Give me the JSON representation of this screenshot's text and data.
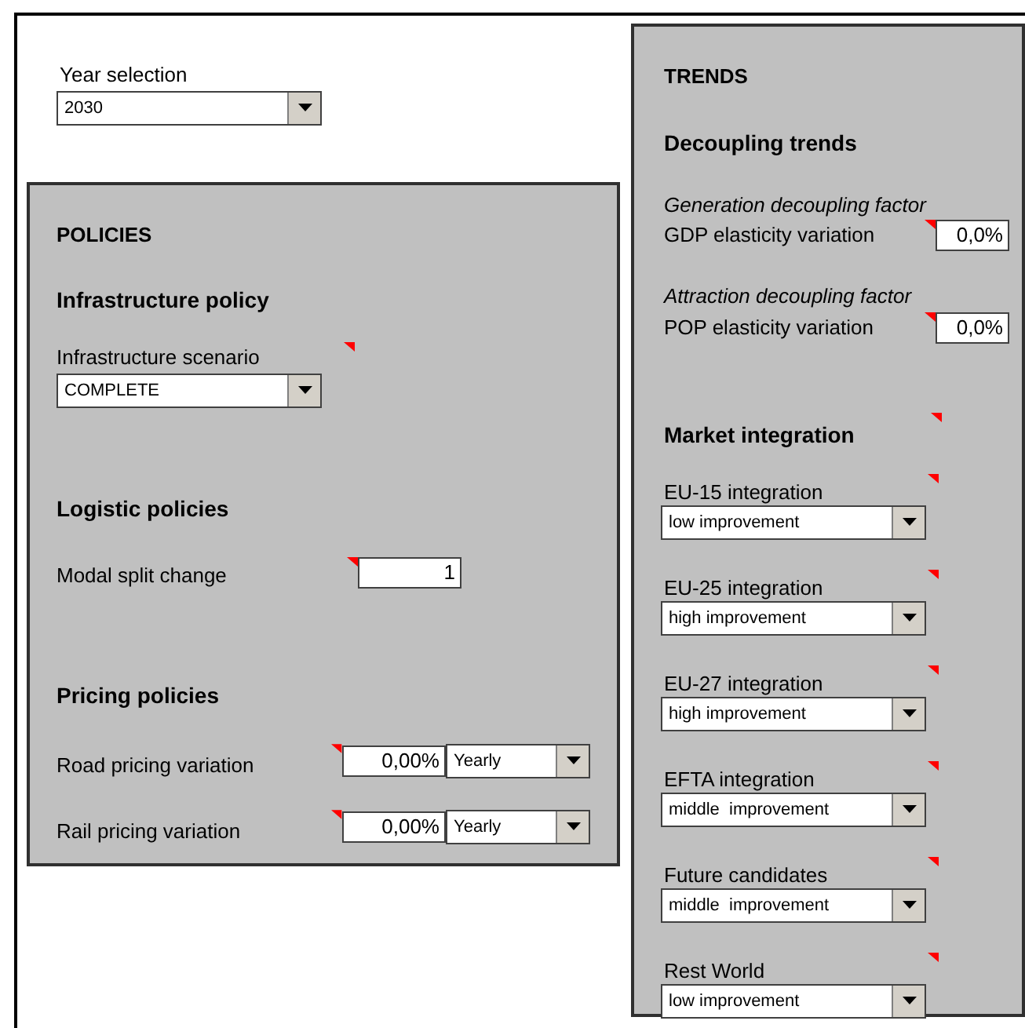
{
  "year_selection": {
    "label": "Year selection",
    "value": "2030"
  },
  "policies": {
    "title": "POLICIES",
    "sections": [
      {
        "heading": "Infrastructure policy",
        "fields": [
          {
            "kind": "dropdown",
            "label": "Infrastructure scenario",
            "value": "COMPLETE",
            "comment": true
          }
        ]
      },
      {
        "heading": "Logistic policies",
        "fields": [
          {
            "kind": "number",
            "label": "Modal split change",
            "value": "1",
            "comment": true
          }
        ]
      },
      {
        "heading": "Pricing policies",
        "fields": [
          {
            "kind": "number_period",
            "label": "Road pricing variation",
            "value": "0,00%",
            "period": "Yearly",
            "comment": true
          },
          {
            "kind": "number_period",
            "label": "Rail pricing variation",
            "value": "0,00%",
            "period": "Yearly",
            "comment": true
          }
        ]
      }
    ]
  },
  "trends": {
    "title": "TRENDS",
    "decoupling": {
      "heading": "Decoupling trends",
      "factors": [
        {
          "caption": "Generation decoupling factor",
          "label": "GDP elasticity variation",
          "value": "0,0%",
          "comment": true
        },
        {
          "caption": "Attraction decoupling factor",
          "label": "POP elasticity variation",
          "value": "0,0%",
          "comment": true
        }
      ]
    },
    "market": {
      "heading": "Market integration",
      "comment": true,
      "items": [
        {
          "label": "EU-15 integration",
          "value": "low improvement",
          "comment": true
        },
        {
          "label": "EU-25 integration",
          "value": "high improvement",
          "comment": true
        },
        {
          "label": "EU-27 integration",
          "value": "high improvement",
          "comment": true
        },
        {
          "label": "EFTA integration",
          "value": "middle  improvement",
          "comment": true
        },
        {
          "label": "Future candidates",
          "value": "middle  improvement",
          "comment": true
        },
        {
          "label": "Rest World",
          "value": "low improvement",
          "comment": true
        }
      ]
    }
  }
}
